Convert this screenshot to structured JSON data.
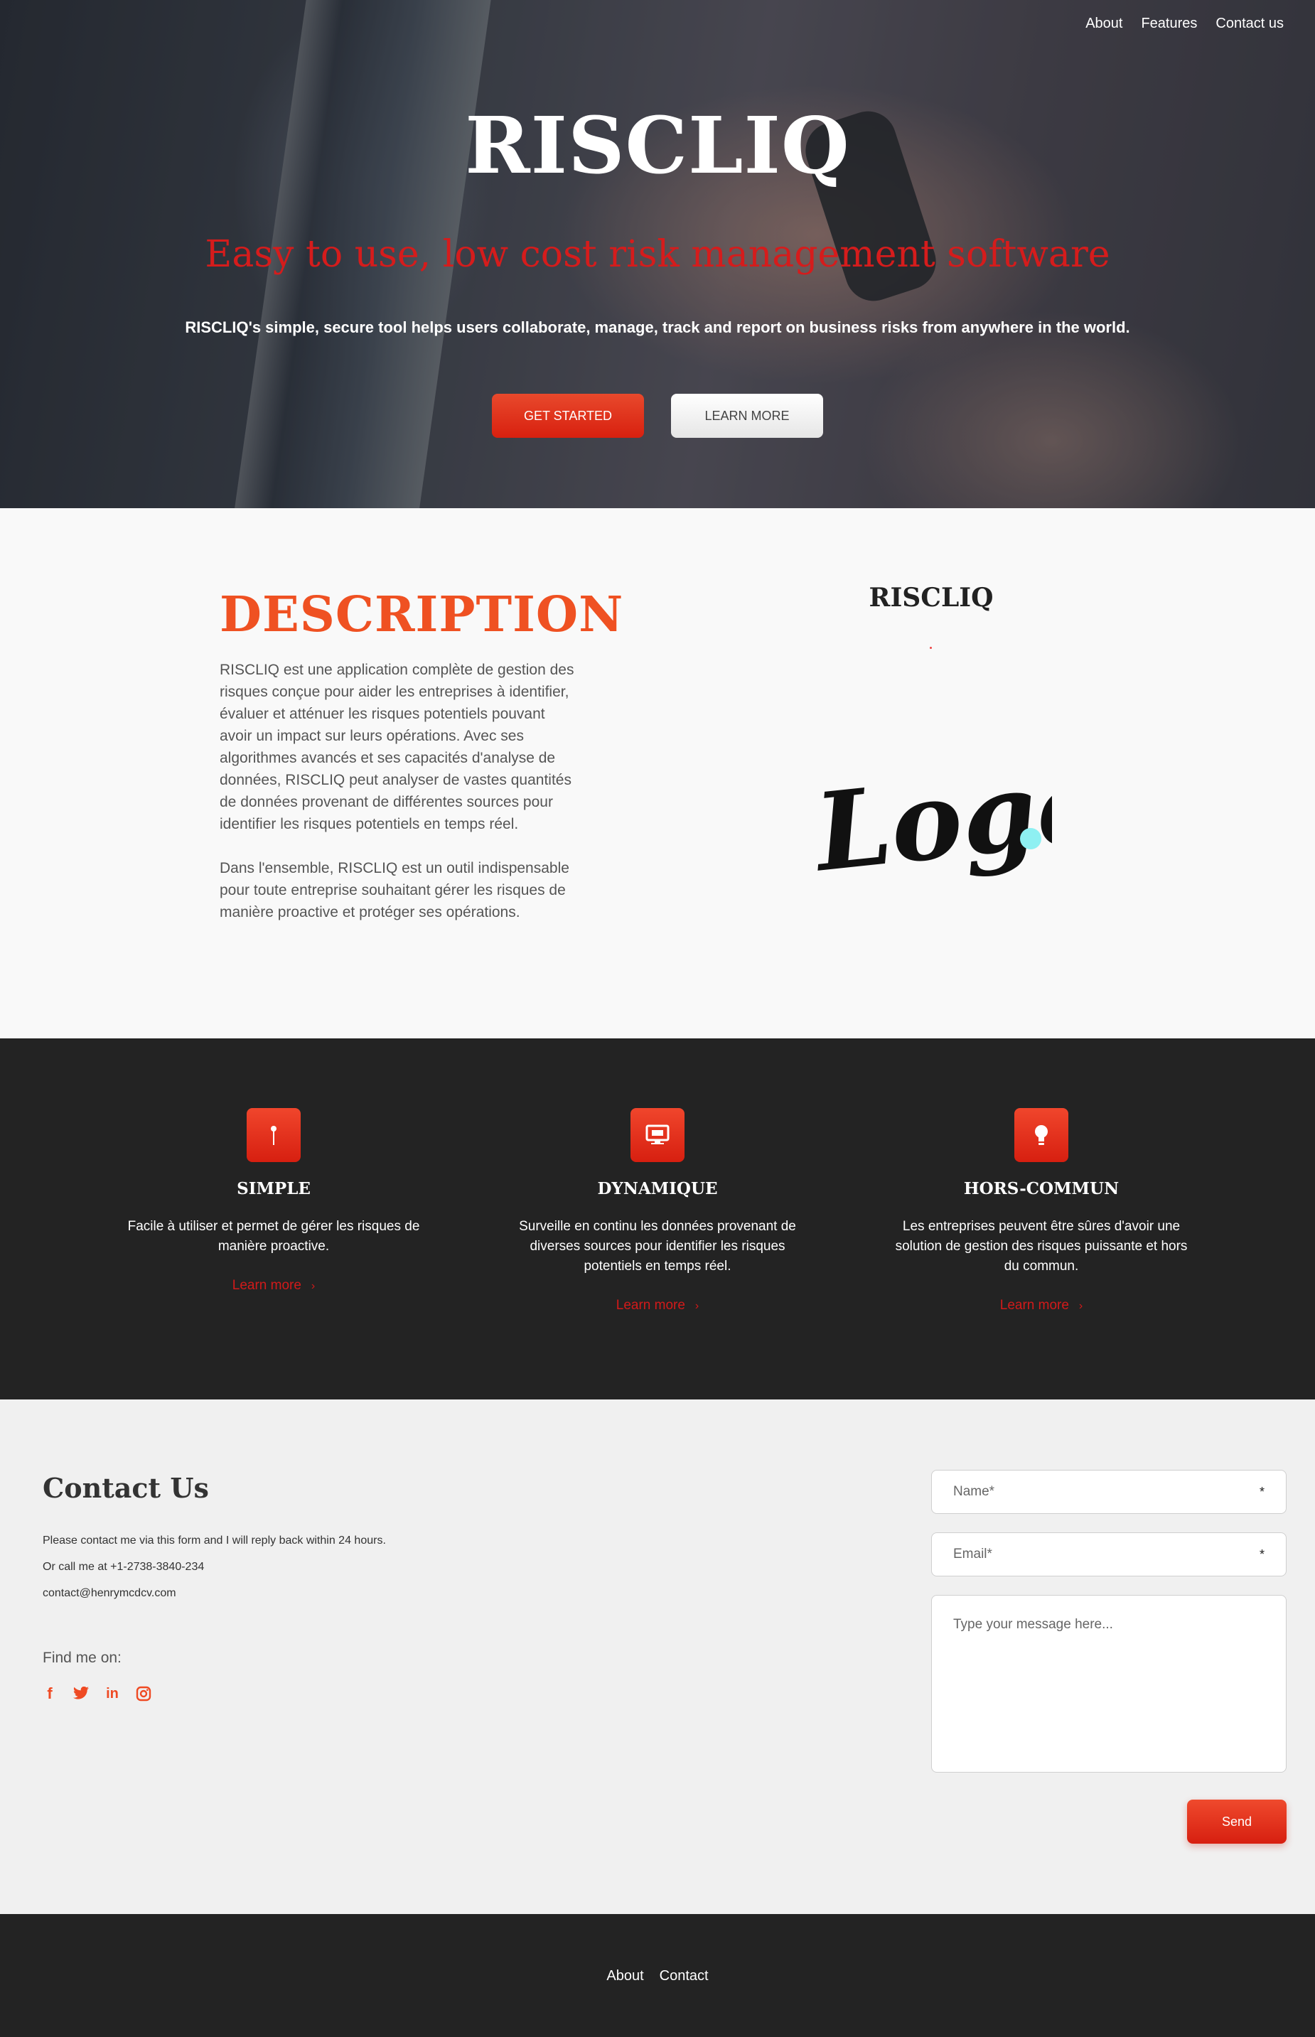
{
  "nav": {
    "items": [
      "About",
      "Features",
      "Contact us"
    ]
  },
  "hero": {
    "title": "RISCLIQ",
    "tagline": "Easy to use, low cost risk management software",
    "subtitle": "RISCLIQ's simple, secure tool helps users collaborate, manage, track and report on business risks from anywhere in the world.",
    "primary_button": "GET STARTED",
    "secondary_button": "LEARN MORE"
  },
  "description": {
    "title": "DESCRIPTION",
    "paragraph1": "RISCLIQ est une application complète de gestion des risques conçue pour aider les entreprises à identifier, évaluer et atténuer les risques potentiels pouvant avoir un impact sur leurs opérations. Avec ses algorithmes avancés et ses capacités d'analyse de données, RISCLIQ peut analyser de vastes quantités de données provenant de différentes sources pour identifier les risques potentiels en temps réel.",
    "paragraph2": "Dans l'ensemble, RISCLIQ est un outil indispensable pour toute entreprise souhaitant gérer les risques de manière proactive et protéger ses opérations.",
    "brand_title": "RISCLIQ",
    "logo_text": "Logo"
  },
  "features": [
    {
      "icon": "pin-icon",
      "title": "SIMPLE",
      "text": "Facile à utiliser et permet de gérer les risques de manière proactive.",
      "link": "Learn more"
    },
    {
      "icon": "monitor-icon",
      "title": "DYNAMIQUE",
      "text": "Surveille en continu les données provenant de diverses sources pour identifier les risques potentiels en temps réel.",
      "link": "Learn more"
    },
    {
      "icon": "lightbulb-icon",
      "title": "HORS-COMMUN",
      "text": "Les entreprises peuvent être sûres d'avoir une solution de gestion des risques puissante et hors du commun.",
      "link": "Learn more"
    }
  ],
  "contact": {
    "title": "Contact Us",
    "line1": "Please contact me via this form and I will reply back within 24 hours.",
    "line2": "Or call me at +1-2738-3840-234",
    "email": "contact@henrymcdcv.com",
    "find_me": "Find me on:",
    "socials": [
      "f",
      "t",
      "in",
      "ig"
    ],
    "form": {
      "name_placeholder": "Name*",
      "email_placeholder": "Email*",
      "message_placeholder": "Type your message here...",
      "required_mark": "*",
      "send_label": "Send"
    }
  },
  "footer": {
    "links": [
      "About",
      "Contact"
    ]
  },
  "colors": {
    "accent": "#ef5122",
    "tagline": "#d51c1c",
    "dark": "#232323"
  }
}
